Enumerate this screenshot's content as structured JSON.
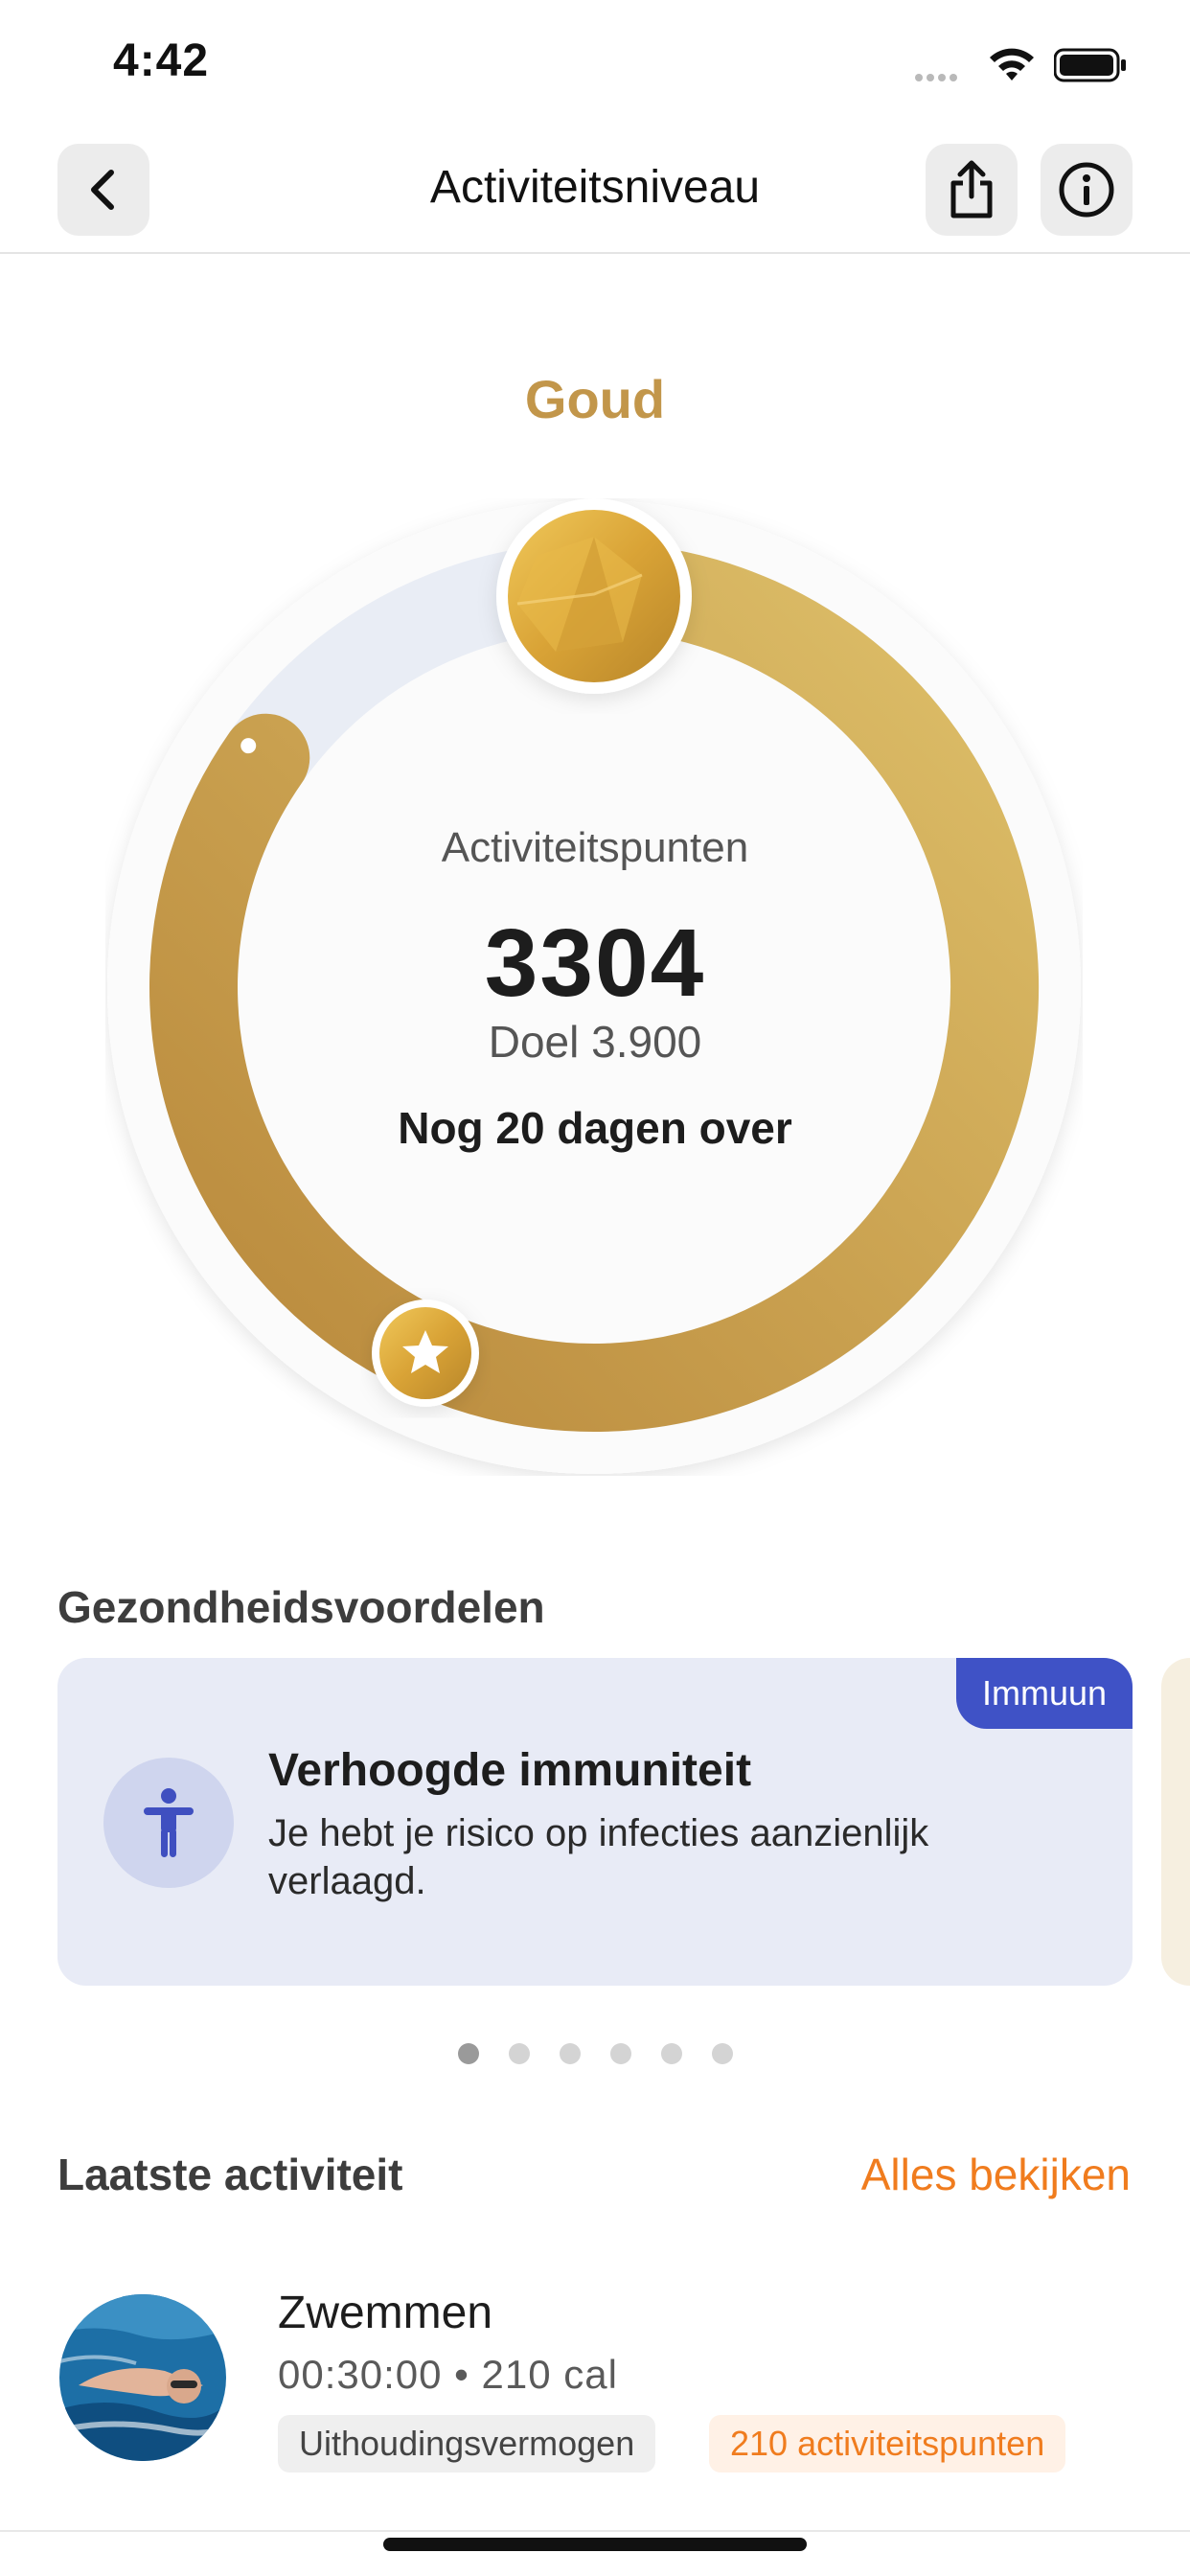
{
  "status_bar": {
    "time": "4:42"
  },
  "header": {
    "title": "Activiteitsniveau"
  },
  "level": {
    "name": "Goud",
    "label": "Activiteitspunten",
    "points": "3304",
    "goal": "Doel 3.900",
    "remaining": "Nog 20 dagen over",
    "progress_fraction": 0.847
  },
  "benefits": {
    "section_title": "Gezondheidsvoordelen",
    "card": {
      "badge": "Immuun",
      "title": "Verhoogde immuniteit",
      "text": "Je hebt je risico op infecties aanzienlijk verlaagd."
    },
    "dots_total": 6,
    "active_dot": 0
  },
  "latest_activity": {
    "section_title": "Laatste activiteit",
    "view_all": "Alles bekijken",
    "item": {
      "title": "Zwemmen",
      "meta": "00:30:00 • 210 cal",
      "tag_category": "Uithoudingsvermogen",
      "tag_points": "210 activiteitspunten"
    }
  },
  "colors": {
    "gold": "#c2964a",
    "accent_orange": "#f07c1e",
    "badge_blue": "#3f52c6"
  }
}
